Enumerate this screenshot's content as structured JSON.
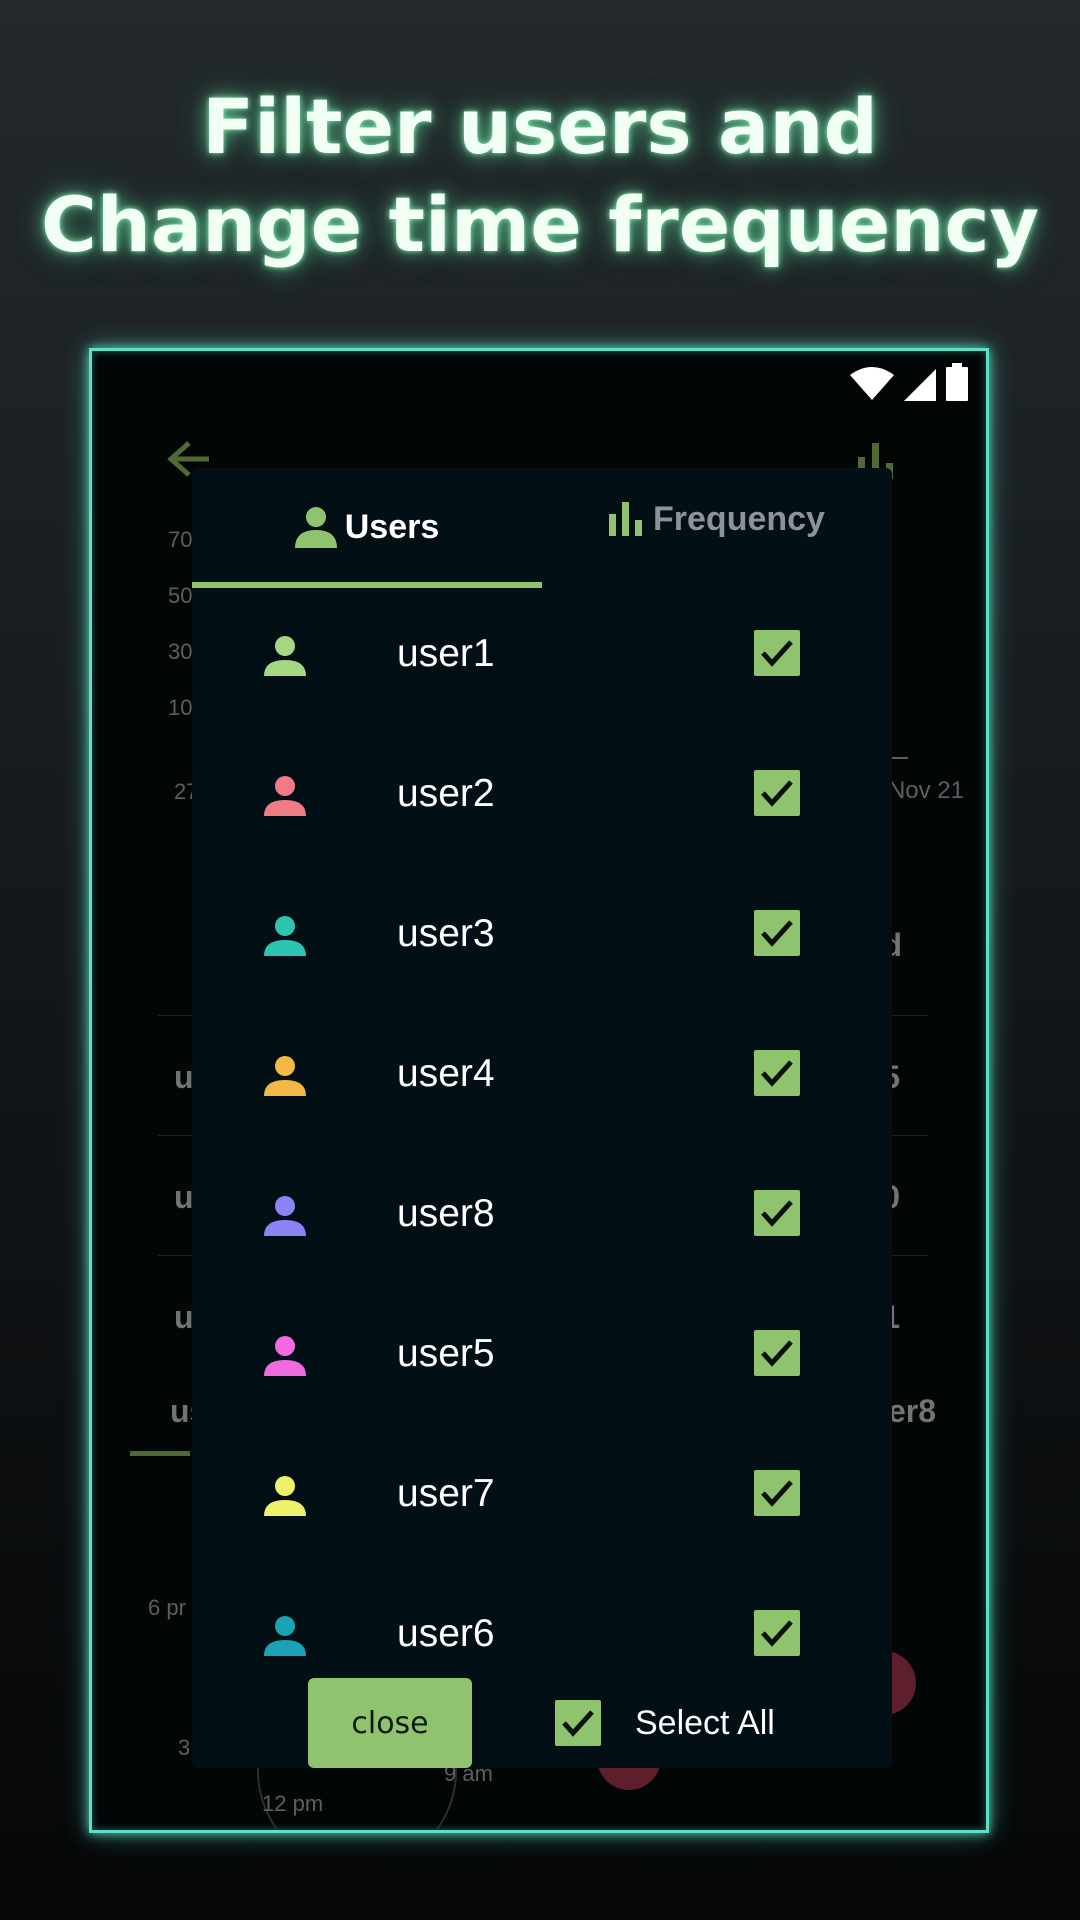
{
  "headline": {
    "line1": "Filter users and",
    "line2": "Change time frequency"
  },
  "status_bar": {
    "icons": [
      "wifi-icon",
      "signal-icon",
      "battery-icon"
    ]
  },
  "background_app": {
    "y_axis_ticks": [
      "70",
      "50",
      "30",
      "10"
    ],
    "x_axis_left": "27",
    "x_axis_right": "Nov 21",
    "column_header_right": "d",
    "row_labels_left": [
      "u",
      "u",
      "u"
    ],
    "row_values_right": [
      "5",
      "0",
      "1"
    ],
    "tab_left_label": "us",
    "tab_right_label": "er8",
    "clock_labels": {
      "left": "6 pr",
      "left2": "3",
      "bottom": "12 pm",
      "right": "9 am"
    }
  },
  "dialog": {
    "tabs": [
      {
        "label": "Users",
        "icon": "person-icon",
        "active": true
      },
      {
        "label": "Frequency",
        "icon": "bar-chart-icon",
        "active": false
      }
    ],
    "users": [
      {
        "name": "user1",
        "color": "#a6d884",
        "checked": true
      },
      {
        "name": "user2",
        "color": "#ee7c82",
        "checked": true
      },
      {
        "name": "user3",
        "color": "#2ec4b2",
        "checked": true
      },
      {
        "name": "user4",
        "color": "#f3b945",
        "checked": true
      },
      {
        "name": "user8",
        "color": "#8c84f4",
        "checked": true
      },
      {
        "name": "user5",
        "color": "#f06bde",
        "checked": true
      },
      {
        "name": "user7",
        "color": "#eef26a",
        "checked": true
      },
      {
        "name": "user6",
        "color": "#1aa3b2",
        "checked": true
      }
    ],
    "close_label": "close",
    "select_all_label": "Select All",
    "select_all_checked": true
  },
  "colors": {
    "accent": "#8fc36e",
    "glow": "#5ee0c6",
    "dialog_bg": "#020f15"
  }
}
